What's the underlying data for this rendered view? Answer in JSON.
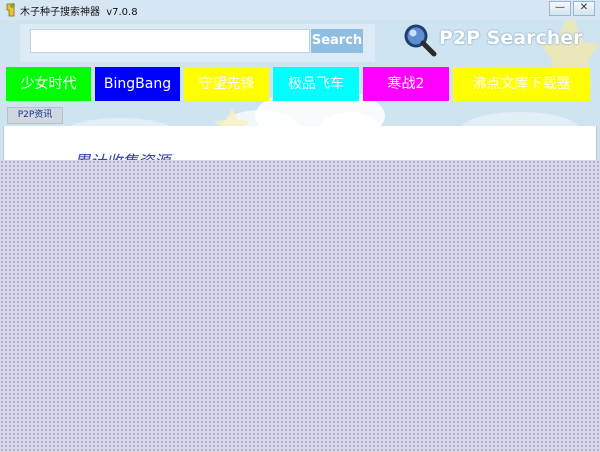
{
  "window": {
    "title": "木子种子搜索神器",
    "version": "v7.0.8",
    "minimize_label": "—",
    "close_label": "✕"
  },
  "search": {
    "value": "",
    "placeholder": "",
    "button_label": "Search"
  },
  "brand": {
    "title": "P2P Searcher",
    "icon": "magnifier-icon"
  },
  "categories": [
    {
      "label": "少女时代",
      "bg": "#00ff00",
      "fg": "#ffffff"
    },
    {
      "label": "BingBang",
      "bg": "#0000ff",
      "fg": "#ffffff"
    },
    {
      "label": "守望先锋",
      "bg": "#ffff00",
      "fg": "#ffffff"
    },
    {
      "label": "极品飞车",
      "bg": "#00ffff",
      "fg": "#ffffff"
    },
    {
      "label": "寒战2",
      "bg": "#ff00ff",
      "fg": "#ffffff"
    },
    {
      "label": "沸点文库下载器",
      "bg": "#ffff00",
      "fg": "#ffffff"
    }
  ],
  "tabs": [
    {
      "label": "P2P资讯"
    }
  ],
  "content": {
    "heading": "累计收集资源"
  },
  "colors": {
    "header_bg": "#cfe4f1",
    "search_button": "#8ebfe3",
    "overlay": "#d9d9ea"
  }
}
